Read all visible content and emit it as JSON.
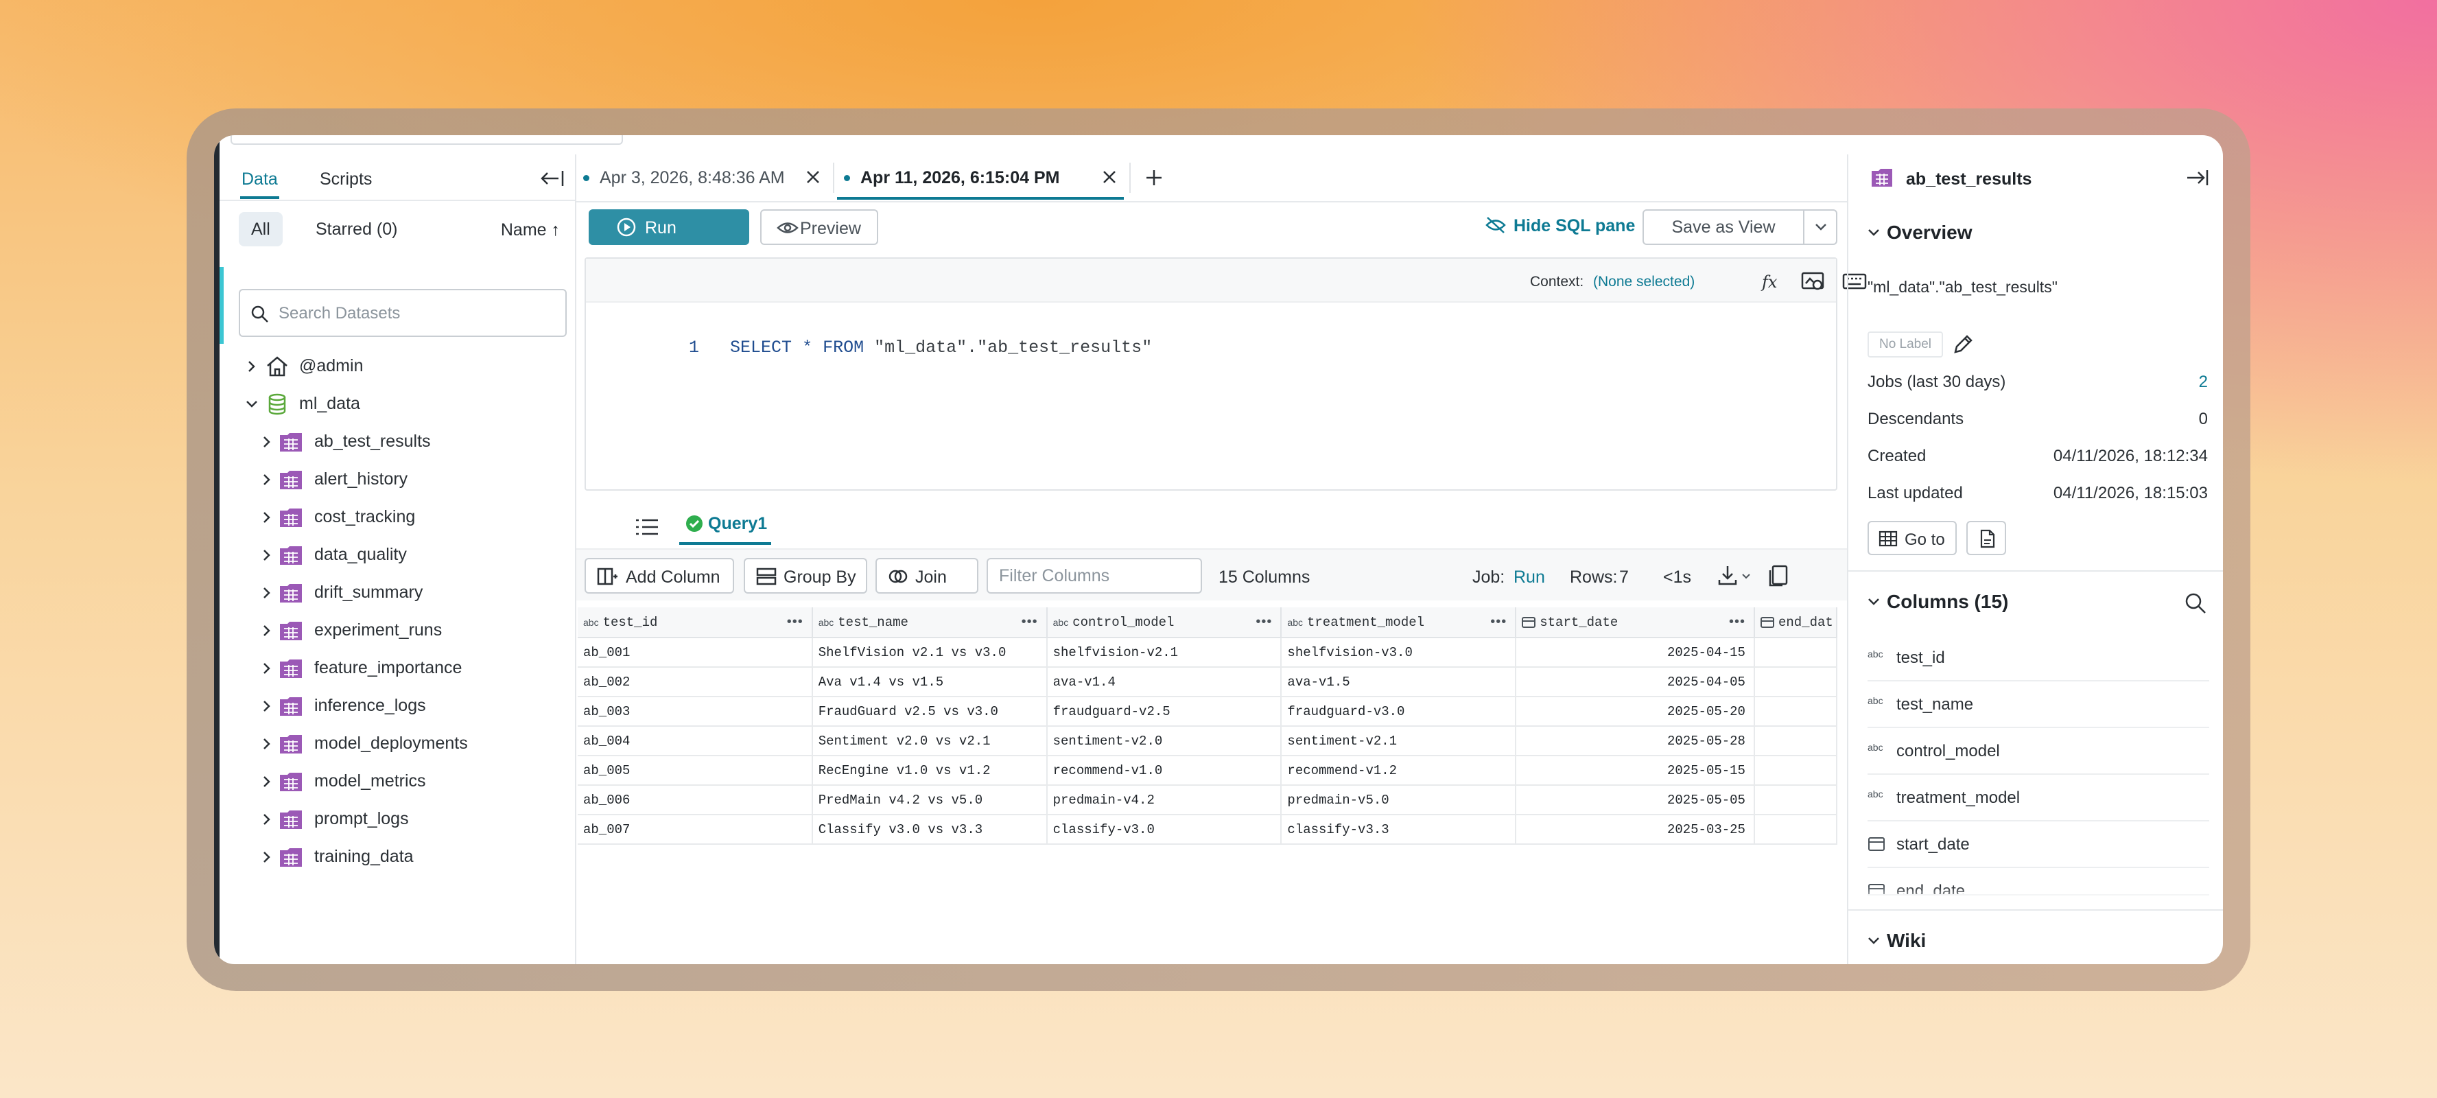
{
  "left_panel": {
    "tabs": [
      "Data",
      "Scripts"
    ],
    "filters": {
      "all": "All",
      "starred": "Starred (0)",
      "sort": "Name ↑"
    },
    "search_placeholder": "Search Datasets",
    "tree": {
      "admin": "@admin",
      "ml_data": "ml_data",
      "tables": [
        "ab_test_results",
        "alert_history",
        "cost_tracking",
        "data_quality",
        "drift_summary",
        "experiment_runs",
        "feature_importance",
        "inference_logs",
        "model_deployments",
        "model_metrics",
        "prompt_logs",
        "training_data"
      ]
    }
  },
  "doc_tabs": [
    {
      "label": "Apr 3, 2026, 8:48:36 AM",
      "active": false
    },
    {
      "label": "Apr 11, 2026, 6:15:04 PM",
      "active": true
    }
  ],
  "toolbar": {
    "run": "Run",
    "preview": "Preview",
    "hide_sql": "Hide SQL pane",
    "save_view": "Save as View"
  },
  "editor": {
    "context_label": "Context:",
    "context_value": "(None selected)",
    "line_number": "1",
    "sql": {
      "select": "SELECT",
      "star": "*",
      "from": "FROM",
      "target": "\"ml_data\".\"ab_test_results\""
    }
  },
  "results": {
    "query_tab": "Query1",
    "add_column": "Add Column",
    "group_by": "Group By",
    "join": "Join",
    "filter_placeholder": "Filter Columns",
    "columns_count": "15 Columns",
    "job_label": "Job:",
    "job_value": "Run",
    "rows_label": "Rows:",
    "rows_value": "7",
    "time": "<1s",
    "columns": [
      {
        "type": "abc",
        "name": "test_id"
      },
      {
        "type": "abc",
        "name": "test_name"
      },
      {
        "type": "abc",
        "name": "control_model"
      },
      {
        "type": "abc",
        "name": "treatment_model"
      },
      {
        "type": "date",
        "name": "start_date"
      },
      {
        "type": "date",
        "name": "end_dat"
      }
    ],
    "rows": [
      [
        "ab_001",
        "ShelfVision v2.1 vs v3.0",
        "shelfvision-v2.1",
        "shelfvision-v3.0",
        "2025-04-15",
        ""
      ],
      [
        "ab_002",
        "Ava v1.4 vs v1.5",
        "ava-v1.4",
        "ava-v1.5",
        "2025-04-05",
        ""
      ],
      [
        "ab_003",
        "FraudGuard v2.5 vs v3.0",
        "fraudguard-v2.5",
        "fraudguard-v3.0",
        "2025-05-20",
        ""
      ],
      [
        "ab_004",
        "Sentiment v2.0 vs v2.1",
        "sentiment-v2.0",
        "sentiment-v2.1",
        "2025-05-28",
        ""
      ],
      [
        "ab_005",
        "RecEngine v1.0 vs v1.2",
        "recommend-v1.0",
        "recommend-v1.2",
        "2025-05-15",
        ""
      ],
      [
        "ab_006",
        "PredMain v4.2 vs v5.0",
        "predmain-v4.2",
        "predmain-v5.0",
        "2025-05-05",
        ""
      ],
      [
        "ab_007",
        "Classify v3.0 vs v3.3",
        "classify-v3.0",
        "classify-v3.3",
        "2025-03-25",
        ""
      ]
    ]
  },
  "right_panel": {
    "title": "ab_test_results",
    "overview": {
      "heading": "Overview",
      "path": "\"ml_data\".\"ab_test_results\"",
      "no_label": "No Label",
      "jobs_label": "Jobs (last 30 days)",
      "jobs_value": "2",
      "descendants_label": "Descendants",
      "descendants_value": "0",
      "created_label": "Created",
      "created_value": "04/11/2026, 18:12:34",
      "updated_label": "Last updated",
      "updated_value": "04/11/2026, 18:15:03",
      "goto": "Go to"
    },
    "columns": {
      "heading": "Columns (15)",
      "items": [
        {
          "type": "abc",
          "name": "test_id"
        },
        {
          "type": "abc",
          "name": "test_name"
        },
        {
          "type": "abc",
          "name": "control_model"
        },
        {
          "type": "abc",
          "name": "treatment_model"
        },
        {
          "type": "date",
          "name": "start_date"
        },
        {
          "type": "date",
          "name": "end_date"
        }
      ]
    },
    "wiki": "Wiki"
  },
  "colors": {
    "accent": "#0d7a93",
    "run_button": "#2e8fa5",
    "dataset_icon": "#9b59b6",
    "space_icon": "#5aa83a"
  }
}
